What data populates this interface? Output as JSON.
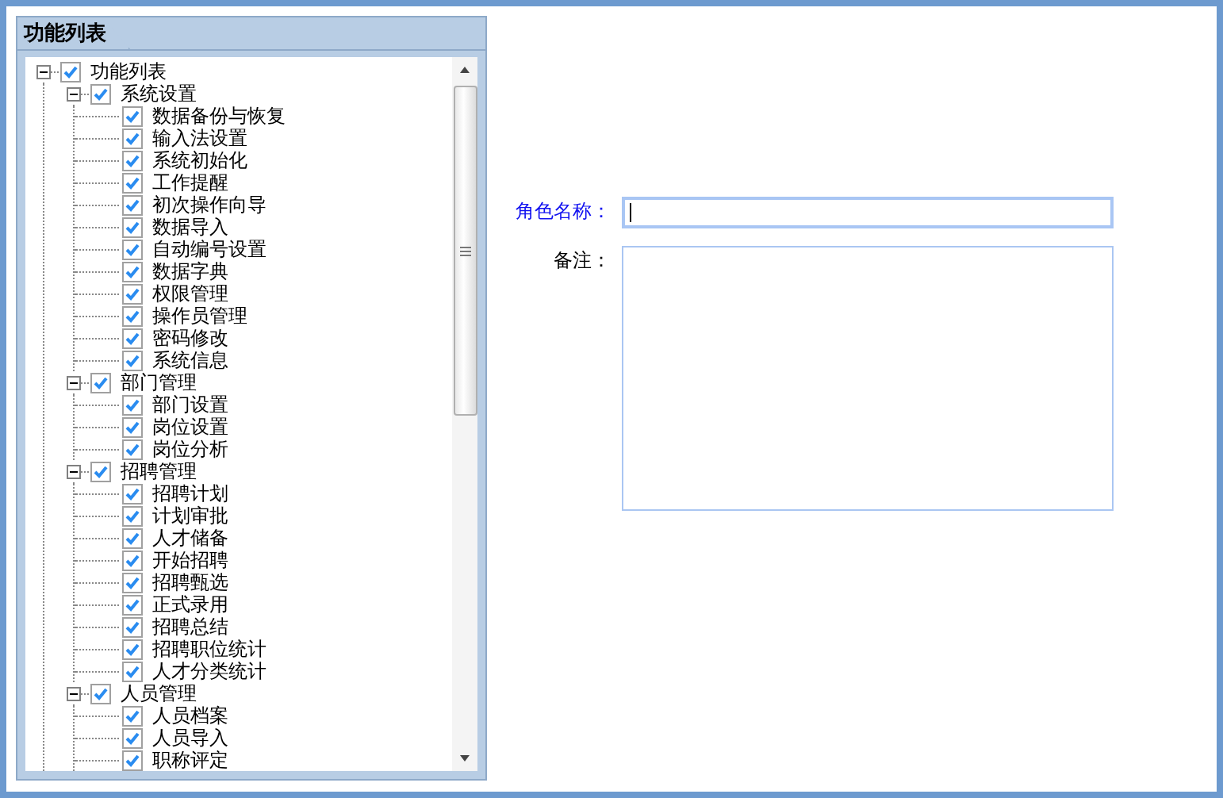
{
  "panel": {
    "tab": "功能列表"
  },
  "tree": [
    {
      "label": "功能列表",
      "checked": true,
      "expanded": true,
      "children": [
        {
          "label": "系统设置",
          "checked": true,
          "expanded": true,
          "children": [
            {
              "label": "数据备份与恢复",
              "checked": true
            },
            {
              "label": "输入法设置",
              "checked": true
            },
            {
              "label": "系统初始化",
              "checked": true
            },
            {
              "label": "工作提醒",
              "checked": true
            },
            {
              "label": "初次操作向导",
              "checked": true
            },
            {
              "label": "数据导入",
              "checked": true
            },
            {
              "label": "自动编号设置",
              "checked": true
            },
            {
              "label": "数据字典",
              "checked": true
            },
            {
              "label": "权限管理",
              "checked": true
            },
            {
              "label": "操作员管理",
              "checked": true
            },
            {
              "label": "密码修改",
              "checked": true
            },
            {
              "label": "系统信息",
              "checked": true
            }
          ]
        },
        {
          "label": "部门管理",
          "checked": true,
          "expanded": true,
          "children": [
            {
              "label": "部门设置",
              "checked": true
            },
            {
              "label": "岗位设置",
              "checked": true
            },
            {
              "label": "岗位分析",
              "checked": true
            }
          ]
        },
        {
          "label": "招聘管理",
          "checked": true,
          "expanded": true,
          "children": [
            {
              "label": "招聘计划",
              "checked": true
            },
            {
              "label": "计划审批",
              "checked": true
            },
            {
              "label": "人才储备",
              "checked": true
            },
            {
              "label": "开始招聘",
              "checked": true
            },
            {
              "label": "招聘甄选",
              "checked": true
            },
            {
              "label": "正式录用",
              "checked": true
            },
            {
              "label": "招聘总结",
              "checked": true
            },
            {
              "label": "招聘职位统计",
              "checked": true
            },
            {
              "label": "人才分类统计",
              "checked": true
            }
          ]
        },
        {
          "label": "人员管理",
          "checked": true,
          "expanded": true,
          "children": [
            {
              "label": "人员档案",
              "checked": true
            },
            {
              "label": "人员导入",
              "checked": true
            },
            {
              "label": "职称评定",
              "checked": true
            }
          ]
        }
      ]
    }
  ],
  "form": {
    "fields": [
      {
        "label": "角色名称：",
        "kind": "input",
        "focused": true
      },
      {
        "label": "备注：",
        "kind": "textarea",
        "focused": false
      }
    ]
  }
}
